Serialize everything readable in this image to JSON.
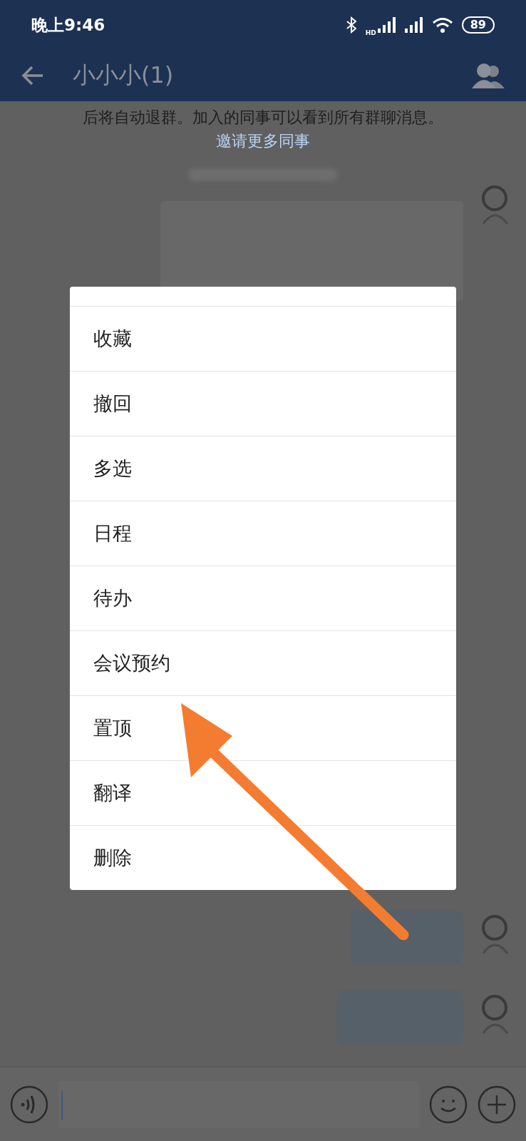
{
  "status_bar": {
    "time": "晚上9:46",
    "network_label": "HD",
    "battery": "89"
  },
  "header": {
    "title": "小小小(1)"
  },
  "notice": {
    "text": "后将自动退群。加入的同事可以看到所有群聊消息。",
    "link": "邀请更多同事"
  },
  "context_menu": {
    "items": [
      {
        "label": "收藏"
      },
      {
        "label": "撤回"
      },
      {
        "label": "多选"
      },
      {
        "label": "日程"
      },
      {
        "label": "待办"
      },
      {
        "label": "会议预约"
      },
      {
        "label": "置顶"
      },
      {
        "label": "翻译"
      },
      {
        "label": "删除"
      }
    ]
  }
}
